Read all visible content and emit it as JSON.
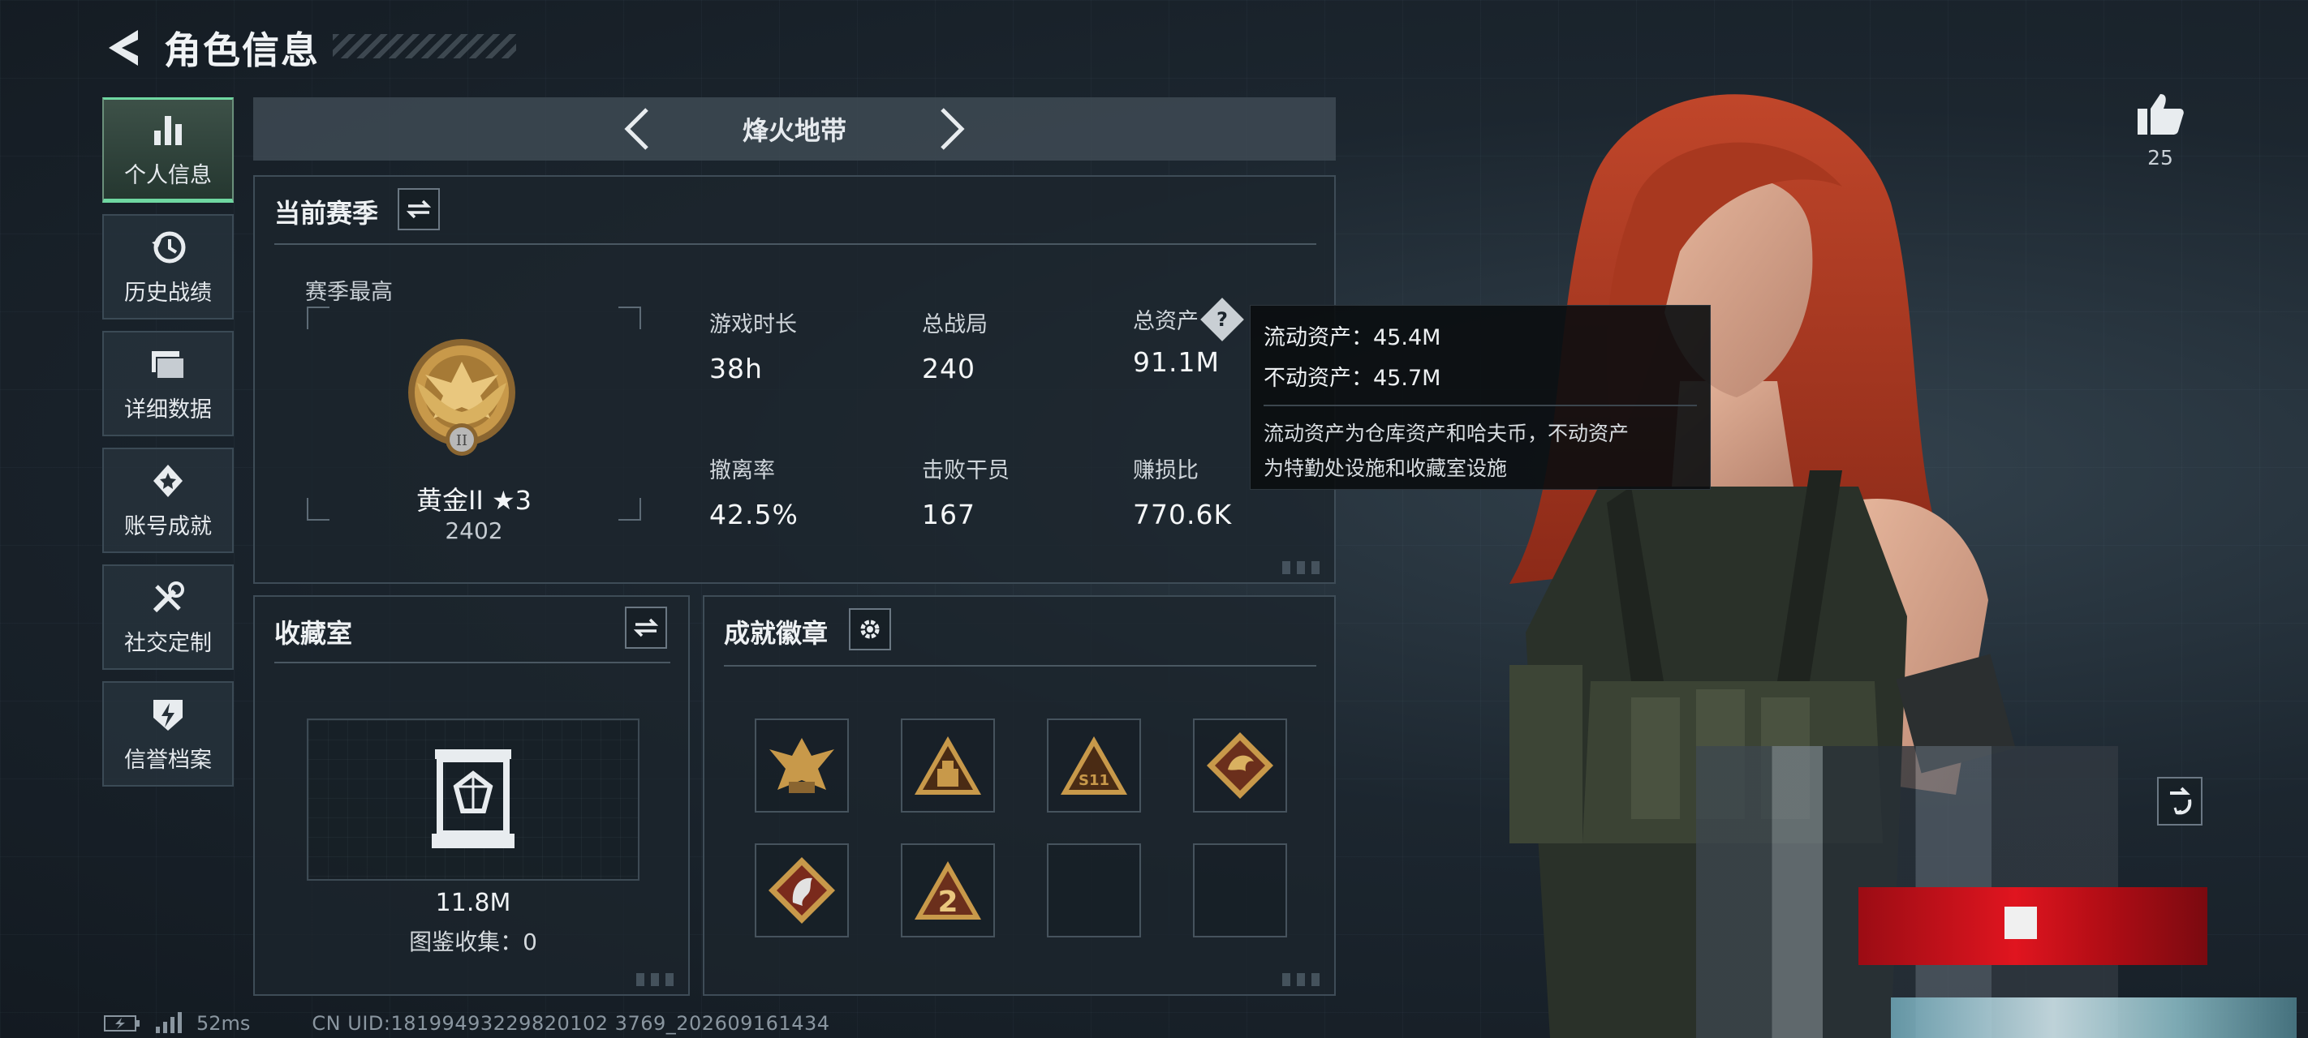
{
  "header": {
    "title": "角色信息"
  },
  "sidebar": {
    "items": [
      {
        "label": "个人信息",
        "icon": "bar-chart-icon",
        "active": true
      },
      {
        "label": "历史战绩",
        "icon": "history-icon",
        "active": false
      },
      {
        "label": "详细数据",
        "icon": "folder-icon",
        "active": false
      },
      {
        "label": "账号成就",
        "icon": "achievement-icon",
        "active": false
      },
      {
        "label": "社交定制",
        "icon": "tools-icon",
        "active": false
      },
      {
        "label": "信誉档案",
        "icon": "credit-icon",
        "active": false
      }
    ]
  },
  "mode": {
    "title": "烽火地带"
  },
  "season": {
    "title": "当前赛季",
    "best_label": "赛季最高",
    "rank_name": "黄金II ★3",
    "rank_score": "2402",
    "stats": [
      {
        "label": "游戏时长",
        "value": "38h"
      },
      {
        "label": "总战局",
        "value": "240"
      },
      {
        "label": "总资产",
        "value": "91.1M"
      },
      {
        "label": "撤离率",
        "value": "42.5%"
      },
      {
        "label": "击败干员",
        "value": "167"
      },
      {
        "label": "赚损比",
        "value": "770.6K"
      }
    ]
  },
  "tooltip": {
    "liquid": "流动资产：45.4M",
    "fixed": "不动资产：45.7M",
    "desc_line1": "流动资产为仓库资产和哈夫币，不动资产",
    "desc_line2": "为特勤处设施和收藏室设施"
  },
  "collection": {
    "title": "收藏室",
    "value": "11.8M",
    "count": "图鉴收集：0"
  },
  "badges": {
    "title": "成就徽章",
    "filled": 6,
    "total": 8
  },
  "likes": {
    "count": "25"
  },
  "footer": {
    "ping": "52ms",
    "uid": "CN UID:18199493229820102 3769_202609161434"
  },
  "colors": {
    "accent": "#6fd7a1",
    "gold": "#c8994a",
    "tooltip_bg": "#0a0d10"
  }
}
